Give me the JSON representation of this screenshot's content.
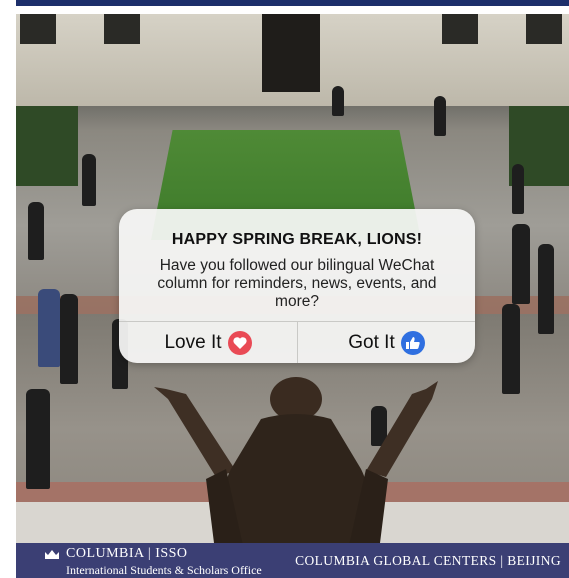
{
  "popup": {
    "title": "HAPPY SPRING BREAK, LIONS!",
    "message": "Have you followed our bilingual WeChat column for reminders, news, events, and more?",
    "love_label": "Love It",
    "got_label": "Got It",
    "love_icon": "heart-icon",
    "got_icon": "thumbs-up-icon",
    "love_color": "#e94a55",
    "got_color": "#2f6fe0"
  },
  "footer": {
    "brand": "COLUMBIA | ISSO",
    "subtitle": "International Students & Scholars Office",
    "right": "COLUMBIA GLOBAL CENTERS | BEIJING",
    "background": "#3b3f74"
  },
  "colors": {
    "top_bar": "#1d2f6b"
  }
}
